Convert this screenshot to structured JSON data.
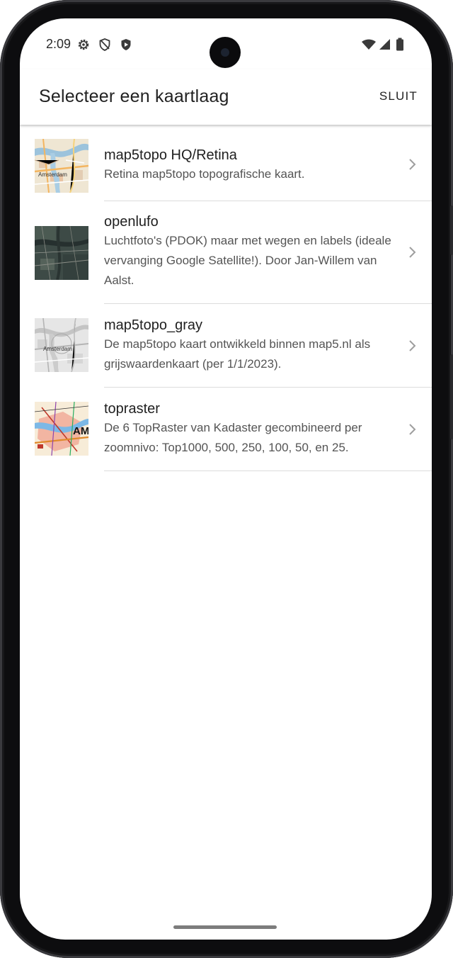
{
  "status_bar": {
    "time": "2:09",
    "icons_left": [
      "gear-icon",
      "shield-outline-icon",
      "shield-filled-icon"
    ],
    "icons_right": [
      "wifi-icon",
      "signal-icon",
      "battery-icon"
    ]
  },
  "header": {
    "title": "Selecteer een kaartlaag",
    "close_label": "SLUIT"
  },
  "layers": [
    {
      "title": "map5topo HQ/Retina",
      "description": "Retina map5topo topografische kaart.",
      "thumbnail_label": "Amsterdam"
    },
    {
      "title": "openlufo",
      "description": "Luchtfoto's (PDOK) maar met wegen en labels (ideale vervanging Google Satellite!). Door Jan-Willem van Aalst."
    },
    {
      "title": "map5topo_gray",
      "description": "De map5topo kaart ontwikkeld binnen map5.nl als grijswaardenkaart (per 1/1/2023).",
      "thumbnail_label": "Amsterdam"
    },
    {
      "title": "topraster",
      "description": "De 6 TopRaster van Kadaster gecombineerd per zoomnivo: Top1000, 500, 250, 100, 50, en 25.",
      "thumbnail_label": "AM"
    }
  ],
  "colors": {
    "background": "#ffffff",
    "text_primary": "#1f1f1f",
    "text_secondary": "#545454",
    "divider": "#dcdcdc",
    "chevron": "#9e9e9e"
  }
}
